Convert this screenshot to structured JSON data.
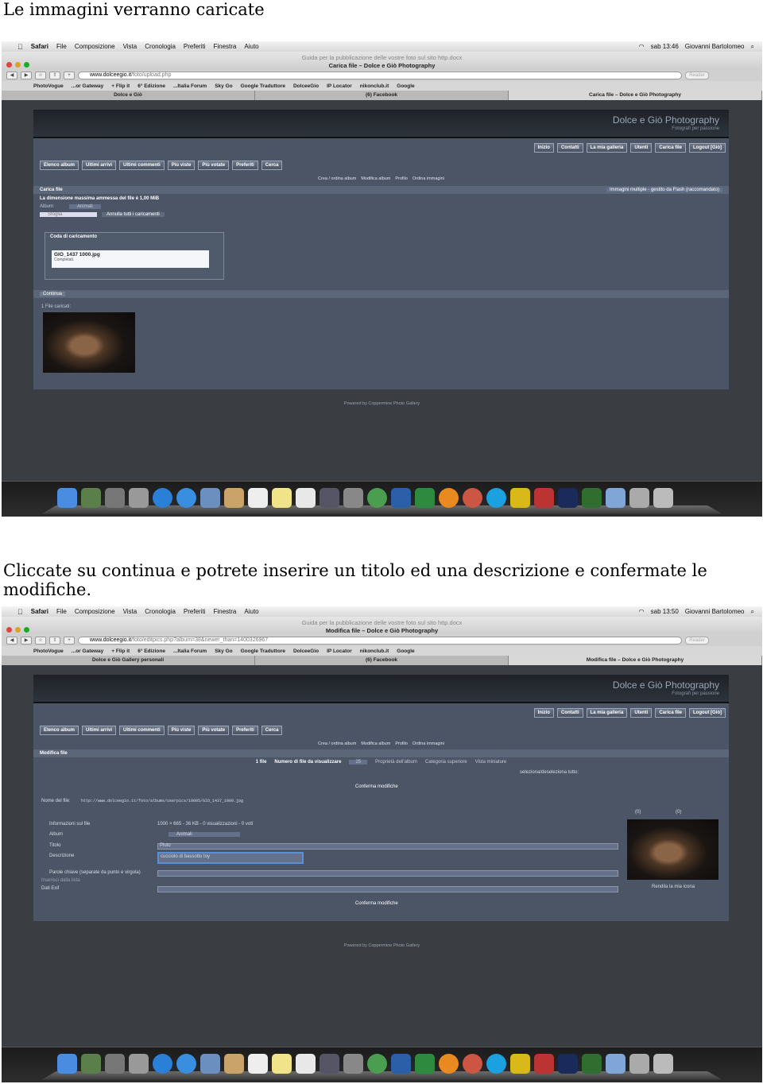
{
  "heading1": "Le immagini verranno caricate",
  "heading2": "Cliccate su continua e potrete inserire un titolo ed una descrizione e confermate le modifiche.",
  "menubar": {
    "app": "Safari",
    "items": [
      "File",
      "Composizione",
      "Vista",
      "Cronologia",
      "Preferiti",
      "Finestra",
      "Aiuto"
    ],
    "user": "Giovanni Bartolomeo"
  },
  "doc_title": "Guida per la pubblicazione delle vostre foto sul sito http.docx",
  "bookmarks": [
    "PhotoVogue",
    "...or Gateway",
    "+ Flip it",
    "6° Edizione",
    "...Italia Forum",
    "Sky Go",
    "Google Traduttore",
    "DolceeGio",
    "IP Locator",
    "nikonclub.it",
    "Google"
  ],
  "reader": "Reader",
  "site": {
    "title": "Dolce e Giò Photography",
    "subtitle": "Fotografi per passione",
    "topnav": [
      "Inizio",
      "Contatti",
      "La mia galleria",
      "Utenti",
      "Carica file",
      "Logout [Giò]"
    ],
    "leftnav": [
      "Elenco album",
      "Ultimi arrivi",
      "Ultimi commenti",
      "Più viste",
      "Più votate",
      "Preferiti",
      "Cerca"
    ],
    "submenu": [
      "Crea / ordina album",
      "Modifica album",
      "Profilo",
      "Ordina immagini"
    ],
    "footer": "Powered by Coppermine Photo Gallery"
  },
  "shot1": {
    "clock": "sab 13:46",
    "window_title": "Carica file – Dolce e Giò Photography",
    "url_host": "www.dolceegio.it",
    "url_path": "/foto/upload.php",
    "tabs": [
      "Dolce e Giò",
      "(6) Facebook",
      "Carica file – Dolce e Giò Photography"
    ],
    "panel_title": "Carica file",
    "help": "?",
    "upload_mode": "Immagini multiple - gestito da Flash (raccomandato)",
    "max_size": "La dimensione massima ammessa del file è 1,00 MiB",
    "album_label": "Album",
    "album_value": "Animali",
    "browse": "Sfoglia",
    "cancel_all": "Annulla tutti i caricamenti",
    "queue_title": "Coda di caricamento",
    "file_name": "GIO_1437 1000.jpg",
    "file_status": "Completati.",
    "continue": "Continua",
    "uploaded": "1 File caricati:"
  },
  "shot2": {
    "clock": "sab 13:50",
    "window_title": "Modifica file – Dolce e Giò Photography",
    "url_host": "www.dolceegio.it",
    "url_path": "/foto/editpics.php?album=38&newer_than=1400326967",
    "tabs": [
      "Dolce e Giò Gallery personali",
      "(6) Facebook",
      "Modifica file – Dolce e Giò Photography"
    ],
    "panel_title": "Modifica file",
    "files_count": "1 file",
    "per_page_label": "Numero di file da visualizzare",
    "per_page": "25",
    "album_props": "Proprietà dell'album",
    "parent_cat": "Categoria superiore",
    "thumbs": "Vista miniature",
    "select_all": "seleziona/deseleziona tutto:",
    "confirm": "Conferma modifiche",
    "file_name_label": "Nome del file:",
    "file_path": "http://www.dolceegio.it/foto/albums/userpics/10005/GIO_1437_1000.jpg",
    "count0a": "(0)",
    "count0b": "(0)",
    "info_label": "Informazioni sul file",
    "info_value": "1000 × 665 - 36 KB - 0 visualizzazioni - 0 voti",
    "album_label": "Album",
    "album_value": "Animali",
    "title_label": "Titolo",
    "title_value": "Pluto",
    "desc_label": "Descrizione",
    "desc_value": "cucciolo di bassotto toy",
    "keywords_label": "Parole chiave (separate da punto e virgola)",
    "from_list": "Inserisci dalla lista",
    "exif_label": "Dati Exif",
    "make_icon": "Rendila la mia icona"
  }
}
